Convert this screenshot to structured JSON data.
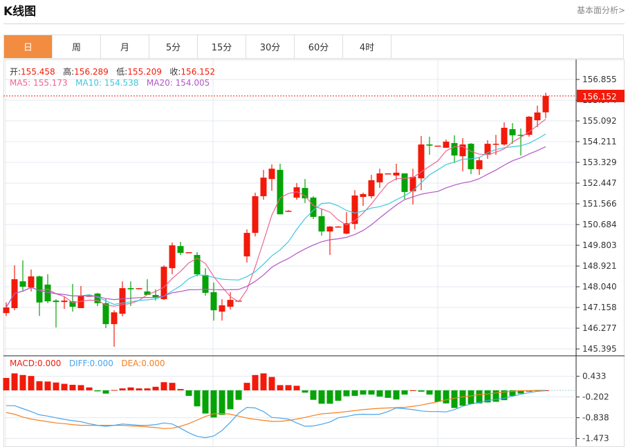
{
  "header": {
    "title": "K线图",
    "link": "基本面分析>"
  },
  "tabs": [
    {
      "label": "日",
      "active": true
    },
    {
      "label": "周"
    },
    {
      "label": "月"
    },
    {
      "label": "5分"
    },
    {
      "label": "15分"
    },
    {
      "label": "30分"
    },
    {
      "label": "60分"
    },
    {
      "label": "4时"
    }
  ],
  "ohlc_legend": {
    "open_label": "开:",
    "open": "155.458",
    "high_label": "高:",
    "high": "156.289",
    "low_label": "低:",
    "low": "155.209",
    "close_label": "收:",
    "close": "156.152"
  },
  "ma_legend": {
    "ma5": "MA5: 155.173",
    "ma10": "MA10: 154.538",
    "ma20": "MA20: 154.005"
  },
  "macd_legend": {
    "macd": "MACD:0.000",
    "diff": "DIFF:0.000",
    "dea": "DEA:0.000"
  },
  "colors": {
    "up": "#f21a0a",
    "down": "#06a306",
    "ma5": "#f0638e",
    "ma10": "#3cc8dc",
    "ma20": "#b455c8",
    "diff": "#48a4ee",
    "dea": "#f7801e",
    "accent": "#f28c40"
  },
  "chart_data": {
    "type": "candlestick",
    "price_axis": {
      "ticks": [
        "156.855",
        "155.974",
        "155.092",
        "154.211",
        "153.329",
        "152.447",
        "151.566",
        "150.684",
        "149.803",
        "148.921",
        "148.040",
        "147.158",
        "146.277",
        "145.395"
      ],
      "range": [
        145.395,
        156.855
      ]
    },
    "last_price": "156.152",
    "candles": [
      [
        146.92,
        147.37,
        146.8,
        147.16
      ],
      [
        147.13,
        148.95,
        147.04,
        148.36
      ],
      [
        148.27,
        149.16,
        147.87,
        148.04
      ],
      [
        148.01,
        148.77,
        147.84,
        148.48
      ],
      [
        148.48,
        148.51,
        146.8,
        147.37
      ],
      [
        148.13,
        148.57,
        147.34,
        147.42
      ],
      [
        147.45,
        147.51,
        146.31,
        147.39
      ],
      [
        147.39,
        147.63,
        147.1,
        147.45
      ],
      [
        147.42,
        148.16,
        146.98,
        147.19
      ],
      [
        147.13,
        148.07,
        147.13,
        147.66
      ],
      [
        147.64,
        147.69,
        147.63,
        147.66
      ],
      [
        147.75,
        147.78,
        147.22,
        147.34
      ],
      [
        147.34,
        147.54,
        146.28,
        146.45
      ],
      [
        146.45,
        147.04,
        145.49,
        146.95
      ],
      [
        146.89,
        148.27,
        146.78,
        147.98
      ],
      [
        147.98,
        148.27,
        147.22,
        147.93
      ],
      [
        147.95,
        147.98,
        147.93,
        147.98
      ],
      [
        147.84,
        148.36,
        147.69,
        147.69
      ],
      [
        147.69,
        147.93,
        147.45,
        147.6
      ],
      [
        147.51,
        148.95,
        147.48,
        148.89
      ],
      [
        148.83,
        149.92,
        148.57,
        149.8
      ],
      [
        149.77,
        149.95,
        149.39,
        149.48
      ],
      [
        149.48,
        149.51,
        149.48,
        149.51
      ],
      [
        149.39,
        149.51,
        148.48,
        148.57
      ],
      [
        148.54,
        148.83,
        147.66,
        147.78
      ],
      [
        147.81,
        148.22,
        146.6,
        147.04
      ],
      [
        146.98,
        147.51,
        146.6,
        147.25
      ],
      [
        147.19,
        147.81,
        147.07,
        147.48
      ],
      [
        147.42,
        147.45,
        147.42,
        147.45
      ],
      [
        149.33,
        150.48,
        149.07,
        150.33
      ],
      [
        150.33,
        152.04,
        150.18,
        151.89
      ],
      [
        151.89,
        153.01,
        151.74,
        152.68
      ],
      [
        152.62,
        153.24,
        152.12,
        153.06
      ],
      [
        153.01,
        153.27,
        151.12,
        151.12
      ],
      [
        151.24,
        151.3,
        151.24,
        151.27
      ],
      [
        151.83,
        152.45,
        151.74,
        152.27
      ],
      [
        152.24,
        152.62,
        151.6,
        151.8
      ],
      [
        151.83,
        151.89,
        150.92,
        151.01
      ],
      [
        151.04,
        151.36,
        150.21,
        150.39
      ],
      [
        150.39,
        150.62,
        149.39,
        150.6
      ],
      [
        150.57,
        150.62,
        150.57,
        150.6
      ],
      [
        150.3,
        151.21,
        150.27,
        150.74
      ],
      [
        150.71,
        152.15,
        150.48,
        151.92
      ],
      [
        151.86,
        152.04,
        151.48,
        151.98
      ],
      [
        151.89,
        152.8,
        151.8,
        152.57
      ],
      [
        152.48,
        153.06,
        152.24,
        152.86
      ],
      [
        152.83,
        152.86,
        152.83,
        152.86
      ],
      [
        152.77,
        153.27,
        152.57,
        152.89
      ],
      [
        152.86,
        152.86,
        151.77,
        152.07
      ],
      [
        152.1,
        153.06,
        151.54,
        152.71
      ],
      [
        152.65,
        154.45,
        152.15,
        154.09
      ],
      [
        154.09,
        154.42,
        153.65,
        154.04
      ],
      [
        154.01,
        154.04,
        154.01,
        154.04
      ],
      [
        153.95,
        154.3,
        153.95,
        154.21
      ],
      [
        154.15,
        154.48,
        153.3,
        153.62
      ],
      [
        153.59,
        154.36,
        152.95,
        154.09
      ],
      [
        154.12,
        154.15,
        152.83,
        153.04
      ],
      [
        153.04,
        153.56,
        152.8,
        153.42
      ],
      [
        153.65,
        154.27,
        153.48,
        154.12
      ],
      [
        154.09,
        154.5,
        153.65,
        154.12
      ],
      [
        154.09,
        155.03,
        154.04,
        154.8
      ],
      [
        154.74,
        155.0,
        154.12,
        154.48
      ],
      [
        154.5,
        154.77,
        153.62,
        154.48
      ],
      [
        154.5,
        155.3,
        154.42,
        155.27
      ],
      [
        155.12,
        155.74,
        154.83,
        155.45
      ],
      [
        155.458,
        156.289,
        155.209,
        156.152
      ]
    ],
    "macd_axis": {
      "ticks": [
        "0.433",
        "-0.202",
        "-0.838",
        "-1.473"
      ]
    },
    "macd_hist": [
      0.38,
      0.52,
      0.47,
      0.44,
      0.28,
      0.27,
      0.24,
      0.2,
      0.17,
      0.16,
      0.09,
      -0.03,
      -0.1,
      0.01,
      0.06,
      0.09,
      0.06,
      0.06,
      0.11,
      0.25,
      0.23,
      0.04,
      -0.17,
      -0.49,
      -0.71,
      -0.83,
      -0.75,
      -0.58,
      -0.29,
      0.23,
      0.47,
      0.52,
      0.41,
      0.16,
      0.16,
      0.14,
      -0.07,
      -0.29,
      -0.41,
      -0.41,
      -0.32,
      -0.18,
      -0.17,
      -0.13,
      -0.13,
      -0.19,
      -0.23,
      -0.28,
      -0.13,
      0.0,
      -0.04,
      -0.13,
      -0.35,
      -0.4,
      -0.54,
      -0.47,
      -0.42,
      -0.4,
      -0.37,
      -0.35,
      -0.3,
      -0.17,
      -0.1,
      -0.04,
      -0.01,
      0.0
    ],
    "diff": [
      -0.47,
      -0.47,
      -0.56,
      -0.65,
      -0.75,
      -0.79,
      -0.84,
      -0.89,
      -0.93,
      -0.96,
      -1.02,
      -1.07,
      -1.1,
      -1.07,
      -1.03,
      -1.05,
      -1.07,
      -1.07,
      -1.05,
      -1.0,
      -1.03,
      -1.16,
      -1.3,
      -1.41,
      -1.45,
      -1.4,
      -1.23,
      -0.98,
      -0.7,
      -0.52,
      -0.54,
      -0.65,
      -0.83,
      -0.85,
      -0.88,
      -1.0,
      -1.1,
      -1.09,
      -1.04,
      -0.97,
      -0.84,
      -0.8,
      -0.75,
      -0.73,
      -0.74,
      -0.73,
      -0.65,
      -0.54,
      -0.56,
      -0.59,
      -0.63,
      -0.65,
      -0.65,
      -0.66,
      -0.59,
      -0.49,
      -0.42,
      -0.37,
      -0.31,
      -0.28,
      -0.24,
      -0.18,
      -0.12,
      -0.07,
      -0.03,
      -0.01
    ],
    "dea": [
      -0.68,
      -0.73,
      -0.82,
      -0.88,
      -0.92,
      -0.96,
      -1.0,
      -1.02,
      -1.05,
      -1.07,
      -1.07,
      -1.07,
      -1.07,
      -1.07,
      -1.07,
      -1.09,
      -1.1,
      -1.12,
      -1.14,
      -1.17,
      -1.16,
      -1.1,
      -1.02,
      -0.91,
      -0.8,
      -0.72,
      -0.71,
      -0.73,
      -0.79,
      -0.85,
      -0.89,
      -0.92,
      -0.95,
      -0.95,
      -0.92,
      -0.88,
      -0.83,
      -0.77,
      -0.72,
      -0.7,
      -0.68,
      -0.65,
      -0.62,
      -0.59,
      -0.57,
      -0.55,
      -0.54,
      -0.53,
      -0.52,
      -0.49,
      -0.45,
      -0.4,
      -0.35,
      -0.29,
      -0.24,
      -0.2,
      -0.17,
      -0.13,
      -0.11,
      -0.08,
      -0.05,
      -0.03,
      -0.01,
      -0.01,
      0.0,
      0.0
    ]
  }
}
